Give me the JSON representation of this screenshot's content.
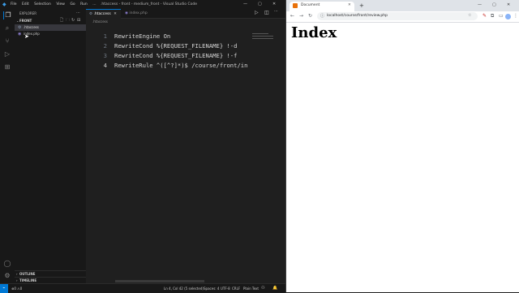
{
  "vscode": {
    "title": ".htaccess - front - medium_front - Visual Studio Code",
    "menu": [
      "File",
      "Edit",
      "Selection",
      "View",
      "Go",
      "Run",
      "..."
    ],
    "sidebar": {
      "header": "EXPLORER",
      "folder": "FRONT",
      "files": [
        {
          "name": ".htaccess",
          "icon": "gear-icon"
        },
        {
          "name": "index.php",
          "icon": "php-file-icon"
        }
      ],
      "outline": "OUTLINE",
      "timeline": "TIMELINE"
    },
    "tabs": [
      {
        "label": ".htaccess",
        "active": true
      },
      {
        "label": "index.php",
        "active": false
      }
    ],
    "breadcrumb": ".htaccess",
    "code_lines": [
      {
        "n": "1",
        "text": "RewriteEngine On"
      },
      {
        "n": "2",
        "text": "RewriteCond %{REQUEST_FILENAME} !-d"
      },
      {
        "n": "3",
        "text": "RewriteCond %{REQUEST_FILENAME} !-f"
      },
      {
        "n": "4",
        "text": "RewriteRule ^([^?]*)$ /course/front/in"
      }
    ],
    "status": {
      "position": "Ln 4, Col 42 (5 selected)",
      "spaces": "Spaces: 4",
      "encoding": "UTF-8",
      "eol": "CRLF",
      "language": "Plain Text"
    },
    "colors": {
      "accent": "#0078d4",
      "background": "#1f1f1f"
    }
  },
  "browser": {
    "tab_title": "Document",
    "url": "localhost/course/front/review.php",
    "heading": "Index"
  }
}
